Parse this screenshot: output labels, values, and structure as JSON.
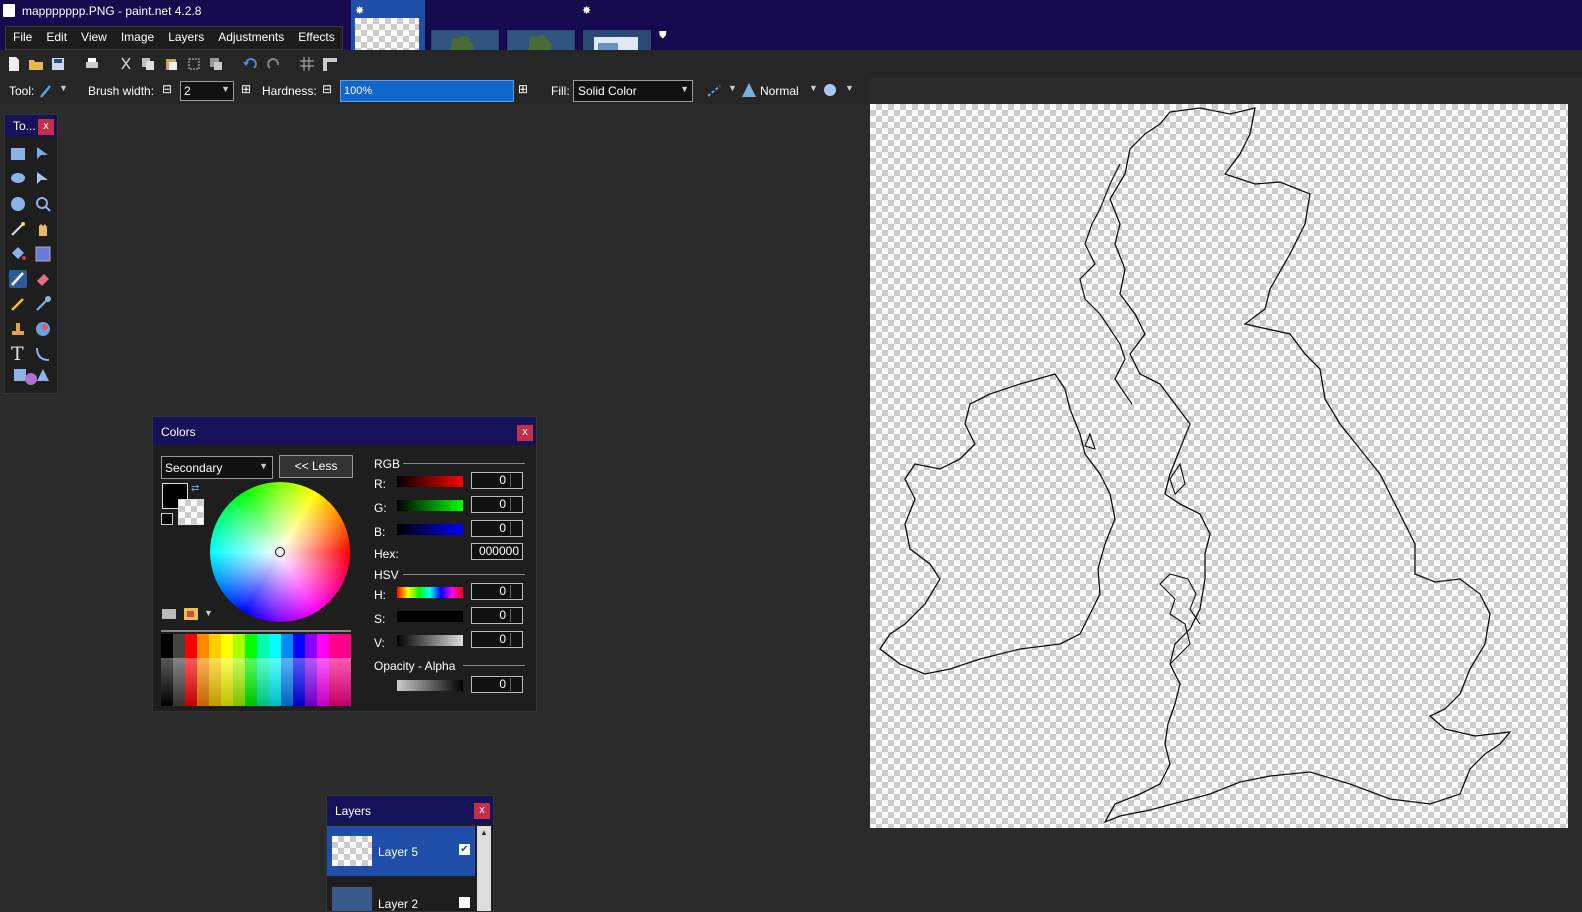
{
  "window": {
    "title": "mappppppp.PNG - paint.net 4.2.8"
  },
  "menu": [
    "File",
    "Edit",
    "View",
    "Image",
    "Layers",
    "Adjustments",
    "Effects"
  ],
  "toolbar": {
    "tool_label": "Tool:",
    "brush_width_label": "Brush width:",
    "brush_width_value": "2",
    "hardness_label": "Hardness:",
    "hardness_value": "100%",
    "fill_label": "Fill:",
    "fill_value": "Solid Color",
    "blend_mode": "Normal"
  },
  "tools_panel": {
    "title": "To...",
    "close": "x"
  },
  "colors_panel": {
    "title": "Colors",
    "close": "x",
    "mode_select": "Secondary",
    "less_button": "<< Less",
    "rgb_section": "RGB",
    "r_label": "R:",
    "r_value": "0",
    "g_label": "G:",
    "g_value": "0",
    "b_label": "B:",
    "b_value": "0",
    "hex_label": "Hex:",
    "hex_value": "000000",
    "hsv_section": "HSV",
    "h_label": "H:",
    "h_value": "0",
    "s_label": "S:",
    "s_value": "0",
    "v_label": "V:",
    "v_value": "0",
    "alpha_section": "Opacity - Alpha",
    "alpha_value": "0",
    "primary_color": "#000000"
  },
  "layers_panel": {
    "title": "Layers",
    "close": "x",
    "layers": [
      {
        "name": "Layer 5",
        "visible": true,
        "selected": true
      },
      {
        "name": "Layer 2",
        "visible": false,
        "selected": false
      }
    ]
  },
  "colors": {
    "accent": "#150a4d",
    "selection": "#1166cc",
    "close": "#c0304a"
  }
}
